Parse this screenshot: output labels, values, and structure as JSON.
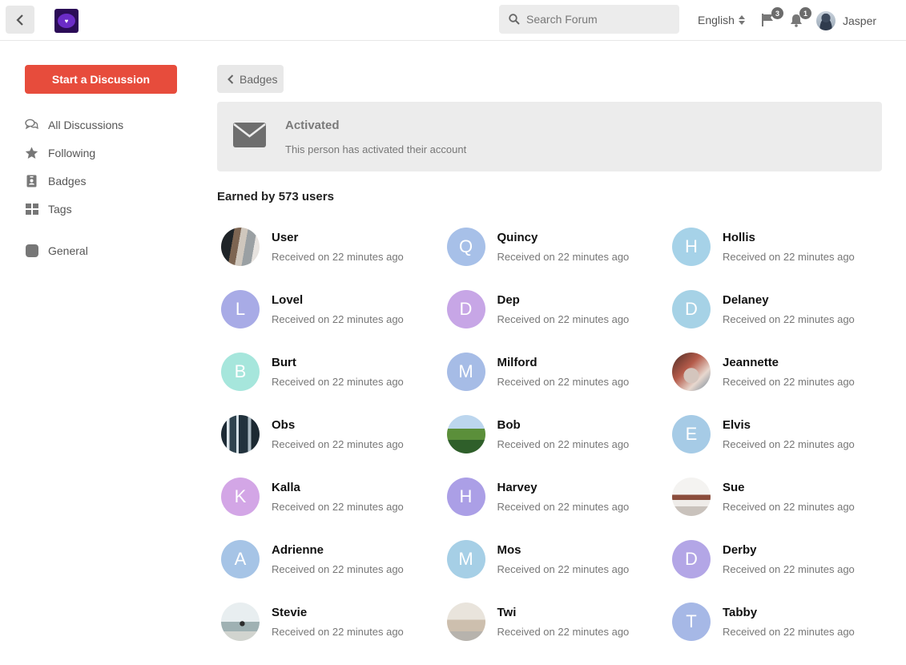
{
  "header": {
    "search_placeholder": "Search Forum",
    "language": "English",
    "flags_count": "3",
    "notifications_count": "1",
    "username": "Jasper"
  },
  "sidebar": {
    "start_label": "Start a Discussion",
    "items": [
      {
        "label": "All Discussions",
        "icon": "comments-icon"
      },
      {
        "label": "Following",
        "icon": "star-icon"
      },
      {
        "label": "Badges",
        "icon": "id-badge-icon"
      },
      {
        "label": "Tags",
        "icon": "grid-icon"
      },
      {
        "label": "General",
        "icon": "tag-square-icon"
      }
    ]
  },
  "breadcrumb": {
    "label": "Badges"
  },
  "badge": {
    "title": "Activated",
    "description": "This person has activated their account",
    "icon": "envelope-icon"
  },
  "earned_label": "Earned by 573 users",
  "users": [
    {
      "name": "User",
      "received": "Received on 22 minutes ago",
      "initial": "",
      "photo": "ph-rock"
    },
    {
      "name": "Quincy",
      "received": "Received on 22 minutes ago",
      "initial": "Q",
      "color": "#a7c0e8"
    },
    {
      "name": "Hollis",
      "received": "Received on 22 minutes ago",
      "initial": "H",
      "color": "#a6d2e8"
    },
    {
      "name": "Lovel",
      "received": "Received on 22 minutes ago",
      "initial": "L",
      "color": "#a8abe6"
    },
    {
      "name": "Dep",
      "received": "Received on 22 minutes ago",
      "initial": "D",
      "color": "#c7a6e6"
    },
    {
      "name": "Delaney",
      "received": "Received on 22 minutes ago",
      "initial": "D",
      "color": "#a6d2e6"
    },
    {
      "name": "Burt",
      "received": "Received on 22 minutes ago",
      "initial": "B",
      "color": "#a6e6dc"
    },
    {
      "name": "Milford",
      "received": "Received on 22 minutes ago",
      "initial": "M",
      "color": "#a6bce6"
    },
    {
      "name": "Jeannette",
      "received": "Received on 22 minutes ago",
      "initial": "",
      "photo": "ph-woman"
    },
    {
      "name": "Obs",
      "received": "Received on 22 minutes ago",
      "initial": "",
      "photo": "ph-forest"
    },
    {
      "name": "Bob",
      "received": "Received on 22 minutes ago",
      "initial": "",
      "photo": "ph-nature"
    },
    {
      "name": "Elvis",
      "received": "Received on 22 minutes ago",
      "initial": "E",
      "color": "#a6cbe6"
    },
    {
      "name": "Kalla",
      "received": "Received on 22 minutes ago",
      "initial": "K",
      "color": "#d3a6e6"
    },
    {
      "name": "Harvey",
      "received": "Received on 22 minutes ago",
      "initial": "H",
      "color": "#ab9fe6"
    },
    {
      "name": "Sue",
      "received": "Received on 22 minutes ago",
      "initial": "",
      "photo": "ph-cup"
    },
    {
      "name": "Adrienne",
      "received": "Received on 22 minutes ago",
      "initial": "A",
      "color": "#a6c4e6"
    },
    {
      "name": "Mos",
      "received": "Received on 22 minutes ago",
      "initial": "M",
      "color": "#a6cfe6"
    },
    {
      "name": "Derby",
      "received": "Received on 22 minutes ago",
      "initial": "D",
      "color": "#b3a6e6"
    },
    {
      "name": "Stevie",
      "received": "Received on 22 minutes ago",
      "initial": "",
      "photo": "ph-beach"
    },
    {
      "name": "Twi",
      "received": "Received on 22 minutes ago",
      "initial": "",
      "photo": "ph-fog"
    },
    {
      "name": "Tabby",
      "received": "Received on 22 minutes ago",
      "initial": "T",
      "color": "#a6b8e6"
    }
  ]
}
